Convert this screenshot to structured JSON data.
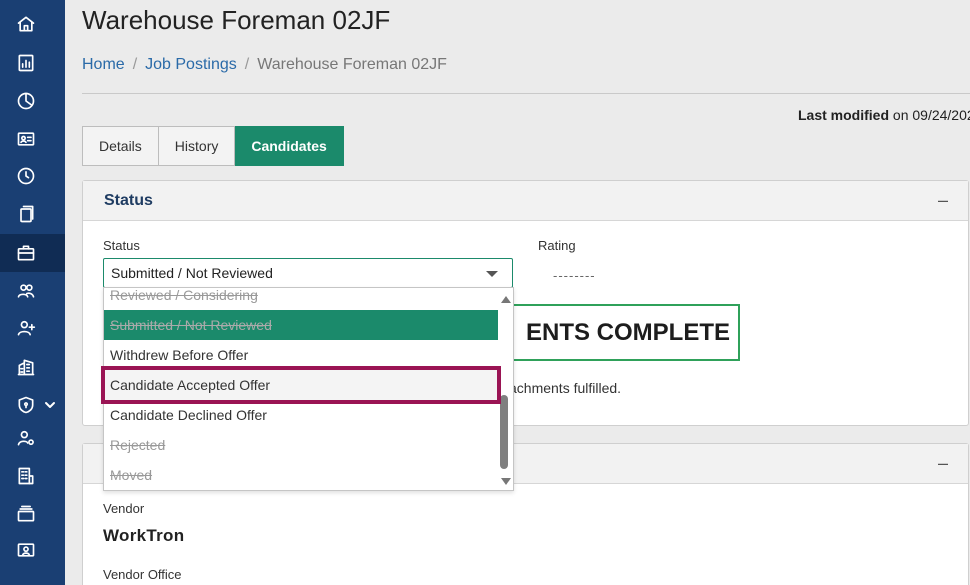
{
  "page": {
    "title": "Warehouse Foreman 02JF",
    "breadcrumb": [
      "Home",
      "Job Postings",
      "Warehouse Foreman 02JF"
    ],
    "breadcrumb_sep": "/",
    "modified_label": "Last modified",
    "modified_rest": " on 09/24/202"
  },
  "tabs": [
    "Details",
    "History",
    "Candidates"
  ],
  "status_panel": {
    "title": "Status",
    "collapse": "–",
    "status_label": "Status",
    "status_value": "Submitted / Not Reviewed",
    "rating_label": "Rating",
    "rating_value": "--------",
    "requirements_text": "ENTS COMPLETE",
    "requirements_note": "achments fulfilled."
  },
  "vendor_panel": {
    "collapse": "–",
    "vendor_label": "Vendor",
    "vendor_name": "WorkTron",
    "office_label": "Vendor Office"
  },
  "dropdown_options": [
    "Reviewed / Considering",
    "Submitted / Not Reviewed",
    "Withdrew Before Offer",
    "Candidate Accepted Offer",
    "Candidate Declined Offer",
    "Rejected",
    "Moved"
  ],
  "colors": {
    "sidebar": "#1a3f73",
    "accent": "#1b8a6b",
    "highlight_border": "#9a1454",
    "requirements_border": "#2fa15a"
  },
  "sidebar_icons": [
    "home-icon",
    "report-icon",
    "pie-chart-icon",
    "id-card-icon",
    "clock-icon",
    "documents-icon",
    "briefcase-icon",
    "group-icon",
    "add-user-icon",
    "building-icon",
    "shield-icon",
    "user-settings-icon",
    "office-building-icon",
    "layers-icon",
    "contact-folder-icon"
  ]
}
